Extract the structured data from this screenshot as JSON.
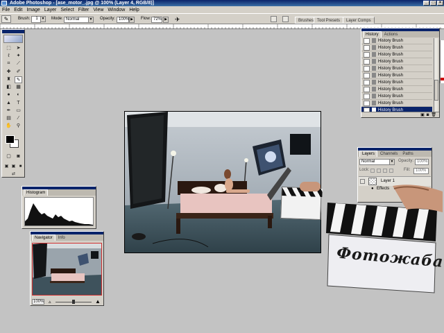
{
  "window": {
    "title": "Adobe Photoshop - [ase_motor_.jpg @ 100% (Layer 4, RGB/8)]",
    "buttons": [
      "_",
      "□",
      "×"
    ]
  },
  "menu": [
    "File",
    "Edit",
    "Image",
    "Layer",
    "Select",
    "Filter",
    "View",
    "Window",
    "Help"
  ],
  "options": {
    "brush_label": "Brush:",
    "brush_size": "1",
    "mode_label": "Mode:",
    "mode_value": "Normal",
    "opacity_label": "Opacity:",
    "opacity_value": "100%",
    "flow_label": "Flow:",
    "flow_value": "72%",
    "palette_tabs": [
      "Brushes",
      "Tool Presets",
      "Layer Comps"
    ]
  },
  "history": {
    "tabs": [
      "History",
      "Actions"
    ],
    "items": [
      "History Brush",
      "History Brush",
      "History Brush",
      "History Brush",
      "History Brush",
      "History Brush",
      "History Brush",
      "History Brush",
      "History Brush",
      "History Brush"
    ],
    "selected": "History Brush"
  },
  "layers": {
    "tabs": [
      "Layers",
      "Channels",
      "Paths"
    ],
    "blend": "Normal",
    "opacity_label": "Opacity:",
    "opacity_value": "100%",
    "lock_label": "Lock:",
    "fill_label": "Fill:",
    "fill_value": "100%",
    "layer_name": "Layer 1",
    "effects_label": "Effects"
  },
  "histogram": {
    "tabs": [
      "Histogram"
    ]
  },
  "navigator": {
    "tabs": [
      "Navigator",
      "Info"
    ],
    "zoom": "100%"
  },
  "watermark": {
    "text": "Фотожаба"
  },
  "colors": {
    "title_bar": "#0a246a",
    "chrome": "#d4d0c8",
    "workspace": "#c3c3c3"
  }
}
